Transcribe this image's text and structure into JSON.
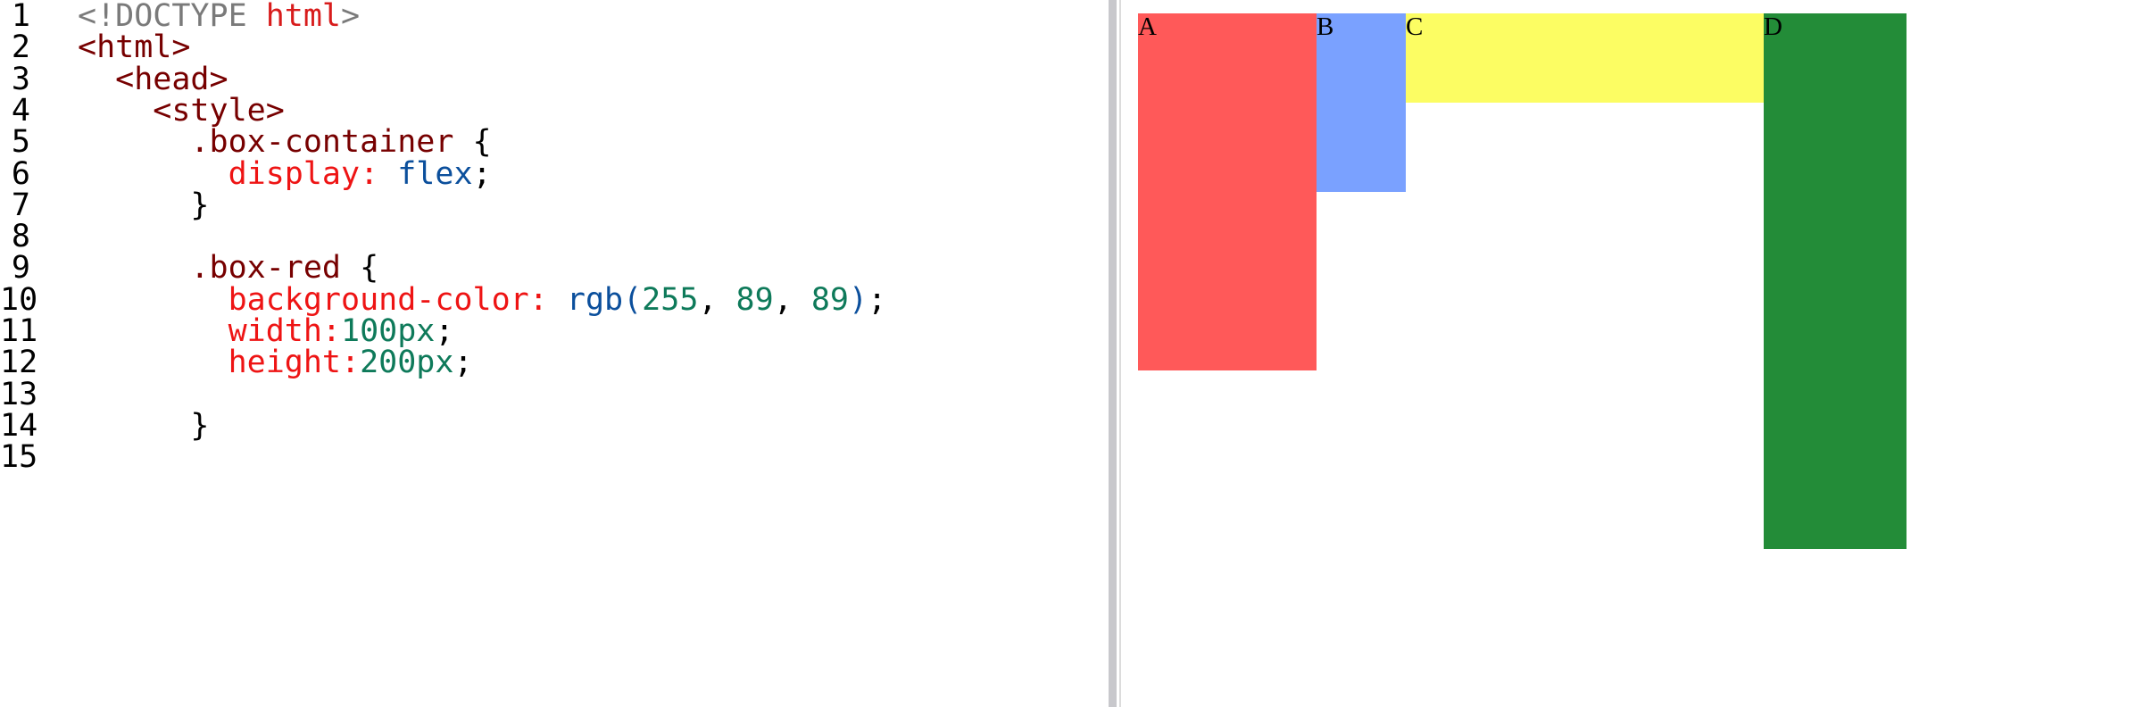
{
  "editor": {
    "lines": [
      {
        "number": "1",
        "tokens": [
          {
            "t": "<!DOCTYPE ",
            "c": "meta"
          },
          {
            "t": "html",
            "c": "kw"
          },
          {
            "t": ">",
            "c": "meta"
          }
        ]
      },
      {
        "number": "2",
        "tokens": [
          {
            "t": "<html>",
            "c": "tag"
          }
        ]
      },
      {
        "number": "3",
        "tokens": [
          {
            "t": "  <head>",
            "c": "tag"
          }
        ]
      },
      {
        "number": "4",
        "tokens": [
          {
            "t": "    <style>",
            "c": "tag"
          }
        ]
      },
      {
        "number": "5",
        "tokens": [
          {
            "t": "      .box-container",
            "c": "sel"
          },
          {
            "t": " {",
            "c": "punc"
          }
        ]
      },
      {
        "number": "6",
        "tokens": [
          {
            "t": "        display:",
            "c": "prop"
          },
          {
            "t": " ",
            "c": "punc"
          },
          {
            "t": "flex",
            "c": "val"
          },
          {
            "t": ";",
            "c": "punc"
          }
        ]
      },
      {
        "number": "7",
        "tokens": [
          {
            "t": "      }",
            "c": "punc"
          }
        ]
      },
      {
        "number": "8",
        "tokens": []
      },
      {
        "number": "9",
        "tokens": [
          {
            "t": "      .box-red",
            "c": "sel"
          },
          {
            "t": " {",
            "c": "punc"
          }
        ]
      },
      {
        "number": "10",
        "tokens": [
          {
            "t": "        background-color:",
            "c": "prop"
          },
          {
            "t": " ",
            "c": "punc"
          },
          {
            "t": "rgb(",
            "c": "val"
          },
          {
            "t": "255",
            "c": "num"
          },
          {
            "t": ", ",
            "c": "punc"
          },
          {
            "t": "89",
            "c": "num"
          },
          {
            "t": ", ",
            "c": "punc"
          },
          {
            "t": "89",
            "c": "num"
          },
          {
            "t": ")",
            "c": "val"
          },
          {
            "t": ";",
            "c": "punc"
          }
        ]
      },
      {
        "number": "11",
        "tokens": [
          {
            "t": "        width:",
            "c": "prop"
          },
          {
            "t": "100px",
            "c": "num"
          },
          {
            "t": ";",
            "c": "punc"
          }
        ]
      },
      {
        "number": "12",
        "tokens": [
          {
            "t": "        height:",
            "c": "prop"
          },
          {
            "t": "200px",
            "c": "num"
          },
          {
            "t": ";",
            "c": "punc"
          }
        ]
      },
      {
        "number": "13",
        "tokens": []
      },
      {
        "number": "14",
        "tokens": [
          {
            "t": "      }",
            "c": "punc"
          }
        ]
      },
      {
        "number": "15",
        "tokens": []
      }
    ]
  },
  "preview": {
    "boxes": [
      {
        "label": "A",
        "color": "#ff5959"
      },
      {
        "label": "B",
        "color": "#7aa1ff"
      },
      {
        "label": "C",
        "color": "#fcfd63"
      },
      {
        "label": "D",
        "color": "#238c38"
      }
    ]
  }
}
